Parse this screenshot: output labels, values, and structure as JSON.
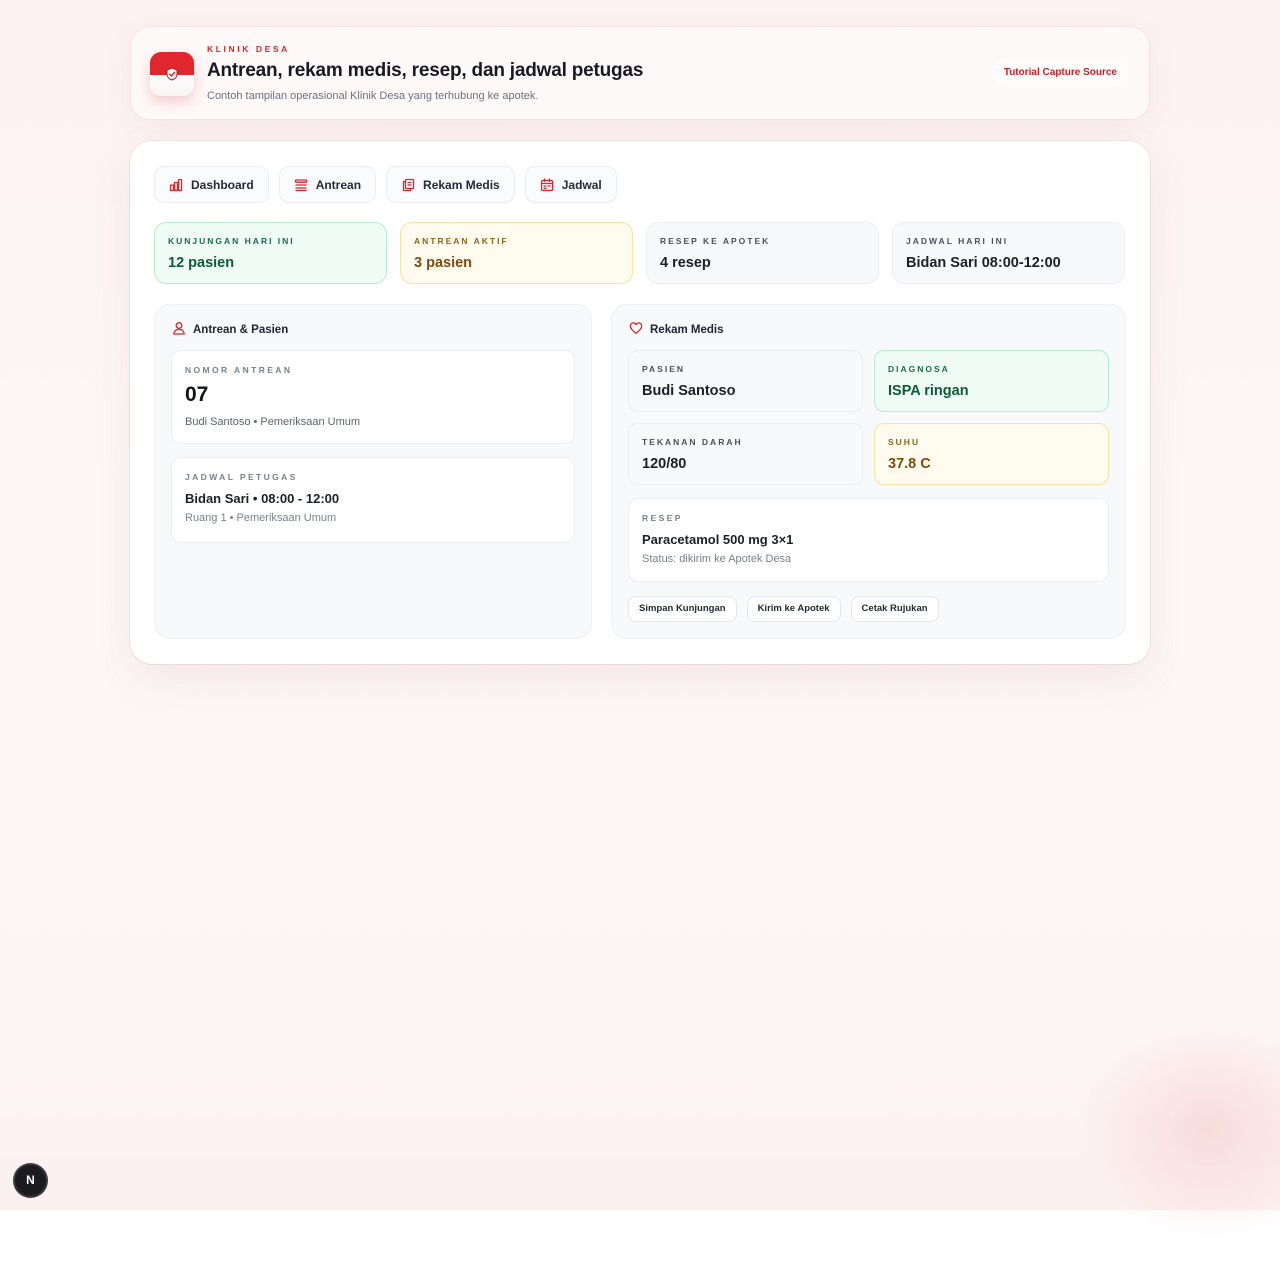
{
  "header": {
    "eyebrow": "KLINIK DESA",
    "title": "Antrean, rekam medis, resep, dan jadwal petugas",
    "subtitle": "Contoh tampilan operasional Klinik Desa yang terhubung ke apotek.",
    "tutorial_link": "Tutorial Capture Source"
  },
  "tabs": [
    {
      "label": "Dashboard",
      "icon": "bar-chart-icon"
    },
    {
      "label": "Antrean",
      "icon": "list-icon"
    },
    {
      "label": "Rekam Medis",
      "icon": "files-icon"
    },
    {
      "label": "Jadwal",
      "icon": "calendar-icon"
    }
  ],
  "stats": [
    {
      "label": "KUNJUNGAN HARI INI",
      "value": "12 pasien",
      "tone": "green"
    },
    {
      "label": "ANTREAN AKTIF",
      "value": "3 pasien",
      "tone": "yellow"
    },
    {
      "label": "RESEP KE APOTEK",
      "value": "4 resep",
      "tone": "neutral"
    },
    {
      "label": "JADWAL HARI INI",
      "value": "Bidan Sari 08:00-12:00",
      "tone": "neutral"
    }
  ],
  "queue_panel": {
    "title": "Antrean & Pasien",
    "icon": "user-icon",
    "queue_number": {
      "label": "NOMOR ANTREAN",
      "value": "07",
      "detail": "Budi Santoso • Pemeriksaan Umum"
    },
    "staff_schedule": {
      "label": "JADWAL PETUGAS",
      "value": "Bidan Sari • 08:00 - 12:00",
      "detail": "Ruang 1 • Pemeriksaan Umum"
    }
  },
  "record_panel": {
    "title": "Rekam Medis",
    "icon": "heart-icon",
    "patient": {
      "label": "PASIEN",
      "value": "Budi Santoso"
    },
    "diagnosis": {
      "label": "DIAGNOSA",
      "value": "ISPA ringan"
    },
    "blood_pressure": {
      "label": "TEKANAN DARAH",
      "value": "120/80"
    },
    "temperature": {
      "label": "SUHU",
      "value": "37.8 C"
    },
    "prescription": {
      "label": "RESEP",
      "value": "Paracetamol 500 mg 3×1",
      "status": "Status: dikirim ke Apotek Desa"
    },
    "actions": [
      "Simpan Kunjungan",
      "Kirim ke Apotek",
      "Cetak Rujukan"
    ]
  },
  "floating_badge": "N",
  "colors": {
    "accent": "#d6262e",
    "green": "#0f5a3a",
    "amber": "#7e4b12"
  }
}
